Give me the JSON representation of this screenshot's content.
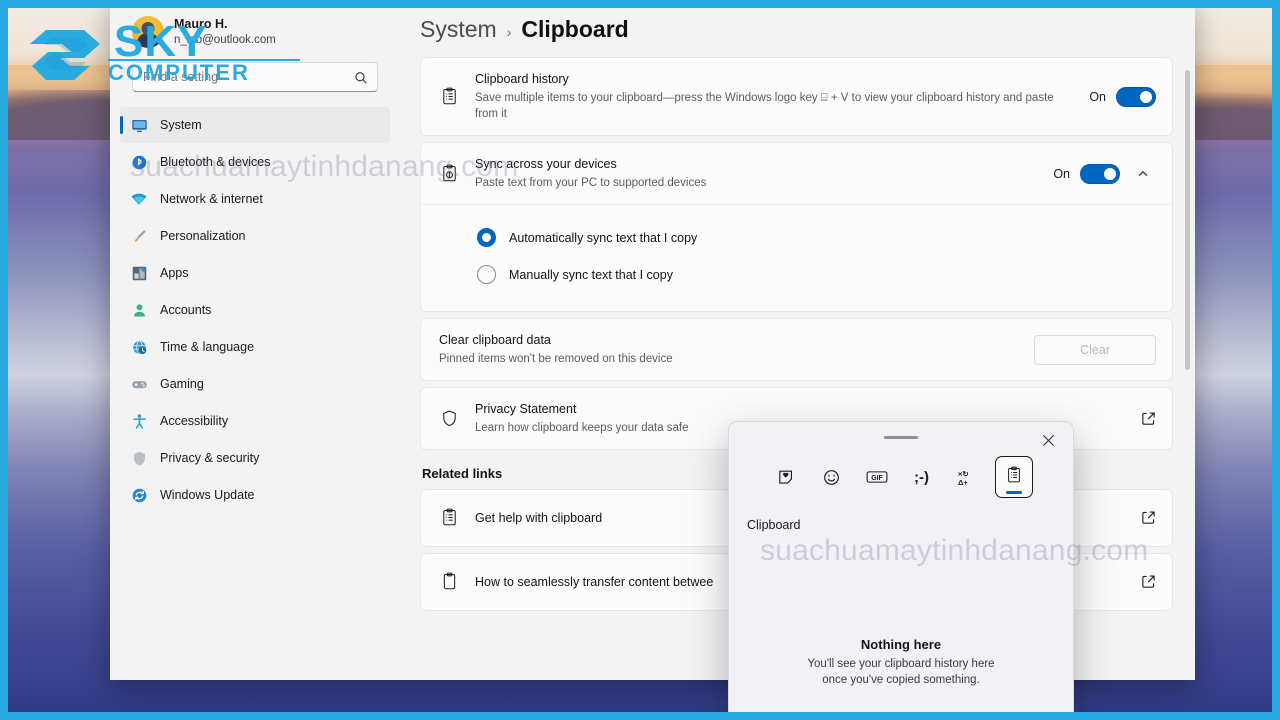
{
  "window": {
    "breadcrumb": {
      "parent": "System",
      "separator": "›",
      "current": "Clipboard"
    }
  },
  "account": {
    "name": "Mauro H.",
    "email": "n_lab@outlook.com"
  },
  "search": {
    "placeholder": "Find a setting",
    "icon": "search-icon"
  },
  "sidebar": {
    "items": [
      {
        "label": "System",
        "icon": "monitor-icon",
        "active": true
      },
      {
        "label": "Bluetooth & devices",
        "icon": "bluetooth-icon",
        "active": false
      },
      {
        "label": "Network & internet",
        "icon": "wifi-icon",
        "active": false
      },
      {
        "label": "Personalization",
        "icon": "paintbrush-icon",
        "active": false
      },
      {
        "label": "Apps",
        "icon": "apps-icon",
        "active": false
      },
      {
        "label": "Accounts",
        "icon": "person-icon",
        "active": false
      },
      {
        "label": "Time & language",
        "icon": "clock-globe-icon",
        "active": false
      },
      {
        "label": "Gaming",
        "icon": "gamepad-icon",
        "active": false
      },
      {
        "label": "Accessibility",
        "icon": "accessibility-icon",
        "active": false
      },
      {
        "label": "Privacy & security",
        "icon": "shield-icon",
        "active": false
      },
      {
        "label": "Windows Update",
        "icon": "update-icon",
        "active": false
      }
    ]
  },
  "settings": {
    "clipboard_history": {
      "title": "Clipboard history",
      "subtitle": "Save multiple items to your clipboard—press the Windows logo key ⌸ + V to view your clipboard history and paste from it",
      "toggle_state": "On",
      "icon": "clipboard-list-icon"
    },
    "sync_devices": {
      "title": "Sync across your devices",
      "subtitle": "Paste text from your PC to supported devices",
      "toggle_state": "On",
      "icon": "clipboard-sync-icon",
      "expanded": true,
      "options": [
        {
          "label": "Automatically sync text that I copy",
          "selected": true
        },
        {
          "label": "Manually sync text that I copy",
          "selected": false
        }
      ]
    },
    "clear_data": {
      "title": "Clear clipboard data",
      "subtitle": "Pinned items won't be removed on this device",
      "button_label": "Clear"
    },
    "privacy_statement": {
      "title": "Privacy Statement",
      "subtitle": "Learn how clipboard keeps your data safe",
      "icon": "shield-icon",
      "action_icon": "external-link-icon"
    }
  },
  "related": {
    "heading": "Related links",
    "links": [
      {
        "label": "Get help with clipboard",
        "icon": "clipboard-list-icon",
        "action_icon": "external-link-icon"
      },
      {
        "label": "How to seamlessly transfer content betwee",
        "icon": "clipboard-icon",
        "action_icon": "external-link-icon"
      }
    ]
  },
  "flyout": {
    "close_icon": "close-icon",
    "grip": "drag-handle",
    "tabs": [
      {
        "name": "sticker-tab",
        "glyph": "♥",
        "selected": false
      },
      {
        "name": "emoji-tab",
        "glyph": "☺",
        "selected": false
      },
      {
        "name": "gif-tab",
        "glyph": "GIF",
        "selected": false
      },
      {
        "name": "kaomoji-tab",
        "glyph": ";-)",
        "selected": false
      },
      {
        "name": "symbols-tab",
        "glyph": "×↻Δ+",
        "selected": false
      },
      {
        "name": "clipboard-tab",
        "glyph": "Ὄb",
        "selected": true
      }
    ],
    "section_label": "Clipboard",
    "empty_title": "Nothing here",
    "empty_subtitle_line1": "You'll see your clipboard history here",
    "empty_subtitle_line2": "once you've copied something."
  },
  "watermarks": {
    "url_text": "suachuamaytinhdanang.com",
    "brand_primary": "SKY",
    "brand_secondary": "COMPUTER"
  },
  "colors": {
    "accent": "#0067C0",
    "frame": "#29ABE2",
    "card_bg": "#fbfbfb",
    "window_bg": "#f3f3f3"
  }
}
